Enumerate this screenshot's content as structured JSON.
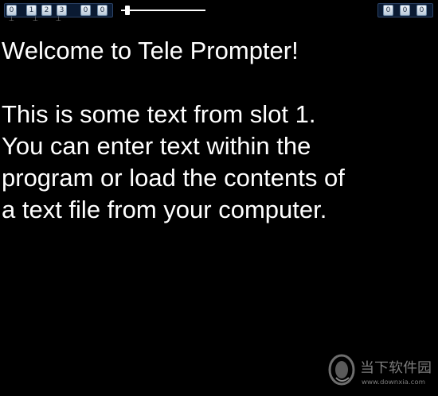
{
  "toolbar": {
    "left_button_1": "0",
    "slot_buttons": [
      "1",
      "2",
      "3"
    ],
    "left_button_2": "0",
    "left_button_3": "0",
    "right_buttons": [
      "0",
      "0",
      "0"
    ],
    "speed_level": 0.05
  },
  "content": {
    "text": "Welcome to Tele Prompter!\n\nThis is some text from slot 1.\nYou can enter text within the\nprogram or load the contents of\na text file from your computer."
  },
  "watermark": {
    "logo": "downxia-logo",
    "name": "当下软件园",
    "url": "www.downxia.com"
  }
}
